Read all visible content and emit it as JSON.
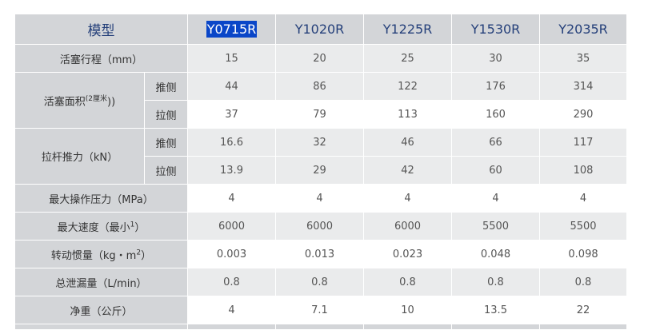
{
  "table": {
    "header_label": "模型",
    "models": [
      "Y0715R",
      "Y1020R",
      "Y1225R",
      "Y1530R",
      "Y2035R"
    ],
    "rows": {
      "stroke": {
        "label": "活塞行程（mm）",
        "values": [
          "15",
          "20",
          "25",
          "30",
          "35"
        ]
      },
      "piston_area": {
        "label": "活塞面积",
        "label_sup": "(2厘米",
        "label_tail": "))",
        "push": {
          "label": "推侧",
          "values": [
            "44",
            "86",
            "122",
            "176",
            "314"
          ]
        },
        "pull": {
          "label": "拉侧",
          "values": [
            "37",
            "79",
            "113",
            "160",
            "290"
          ]
        }
      },
      "rod_force": {
        "label": "拉杆推力（kN）",
        "push": {
          "label": "推侧",
          "values": [
            "16.6",
            "32",
            "46",
            "66",
            "117"
          ]
        },
        "pull": {
          "label": "拉侧",
          "values": [
            "13.9",
            "29",
            "42",
            "60",
            "108"
          ]
        }
      },
      "max_pressure": {
        "label": "最大操作压力（MPa）",
        "values": [
          "4",
          "4",
          "4",
          "4",
          "4"
        ]
      },
      "max_speed": {
        "label": "最大速度（最小",
        "label_sup": "1",
        "label_tail": "）",
        "values": [
          "6000",
          "6000",
          "6000",
          "5500",
          "5500"
        ]
      },
      "inertia": {
        "label": "转动惯量（kg・m",
        "label_sup": "2",
        "label_tail": "）",
        "values": [
          "0.003",
          "0.013",
          "0.023",
          "0.048",
          "0.098"
        ]
      },
      "leakage": {
        "label": "总泄漏量（L/min）",
        "values": [
          "0.8",
          "0.8",
          "0.8",
          "0.8",
          "0.8"
        ]
      },
      "weight": {
        "label": "净重（公斤）",
        "values": [
          "4",
          "7.1",
          "10",
          "13.5",
          "22"
        ]
      }
    }
  }
}
